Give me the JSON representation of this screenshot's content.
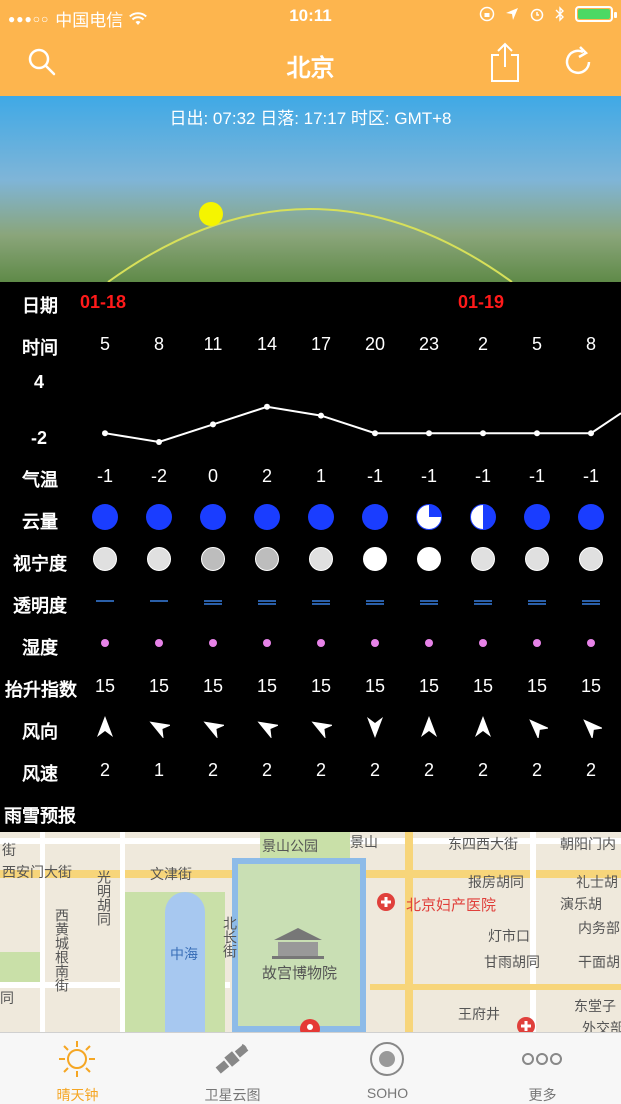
{
  "status": {
    "carrier": "中国电信",
    "time": "10:11"
  },
  "nav": {
    "title": "北京",
    "search_icon": "search-icon",
    "share_icon": "share-icon",
    "refresh_icon": "refresh-icon"
  },
  "sun": {
    "info": "日出: 07:32   日落: 17:17   时区: GMT+8"
  },
  "table": {
    "labels": {
      "date": "日期",
      "time": "时间",
      "temp": "气温",
      "cloud": "云量",
      "seeing": "视宁度",
      "transparency": "透明度",
      "humidity": "湿度",
      "lifted": "抬升指数",
      "wind_dir": "风向",
      "wind_speed": "风速",
      "precip": "雨雪预报"
    },
    "chart_axis": {
      "top": "4",
      "bottom": "-2"
    },
    "dates": [
      "01-18",
      "01-19"
    ],
    "hours": [
      "5",
      "8",
      "11",
      "14",
      "17",
      "20",
      "23",
      "2",
      "5",
      "8"
    ],
    "temps": [
      "-1",
      "-2",
      "0",
      "2",
      "1",
      "-1",
      "-1",
      "-1",
      "-1",
      "-1"
    ],
    "cloud_cover": [
      1,
      1,
      1,
      1,
      1,
      1,
      0.25,
      0.5,
      1,
      1
    ],
    "seeing_colors": [
      "#e0e0e0",
      "#e0e0e0",
      "#bdbdbd",
      "#bdbdbd",
      "#e0e0e0",
      "#ffffff",
      "#ffffff",
      "#e0e0e0",
      "#e0e0e0",
      "#e0e0e0"
    ],
    "transparency_lines": [
      1,
      1,
      2,
      2,
      2,
      2,
      2,
      2,
      2,
      2
    ],
    "lifted": [
      "15",
      "15",
      "15",
      "15",
      "15",
      "15",
      "15",
      "15",
      "15",
      "15"
    ],
    "wind_dir_deg": [
      0,
      300,
      300,
      300,
      300,
      180,
      0,
      0,
      315,
      315
    ],
    "wind_speed": [
      "2",
      "1",
      "2",
      "2",
      "2",
      "2",
      "2",
      "2",
      "2",
      "2"
    ]
  },
  "chart_data": {
    "type": "line",
    "x": [
      "5",
      "8",
      "11",
      "14",
      "17",
      "20",
      "23",
      "2",
      "5",
      "8"
    ],
    "series": [
      {
        "values": [
          -1,
          -2,
          0,
          2,
          1,
          -1,
          -1,
          -1,
          -1,
          -1
        ]
      }
    ],
    "ylim": [
      -2,
      4
    ]
  },
  "map": {
    "labels": [
      "景山公园",
      "景山",
      "东四西大街",
      "朝阳门内",
      "西安门大街",
      "文津街",
      "北京妇产医院",
      "报房胡同",
      "礼士胡",
      "演乐胡",
      "内务部",
      "西黄城根南街",
      "光明胡同",
      "北长街",
      "中海",
      "故宫博物院",
      "灯市口",
      "甘雨胡同",
      "干面胡",
      "王府井",
      "东堂子",
      "外交部",
      "街",
      "同"
    ]
  },
  "tabs": [
    {
      "label": "晴天钟",
      "icon": "sun-icon"
    },
    {
      "label": "卫星云图",
      "icon": "satellite-icon"
    },
    {
      "label": "SOHO",
      "icon": "soho-icon"
    },
    {
      "label": "更多",
      "icon": "more-icon"
    }
  ]
}
